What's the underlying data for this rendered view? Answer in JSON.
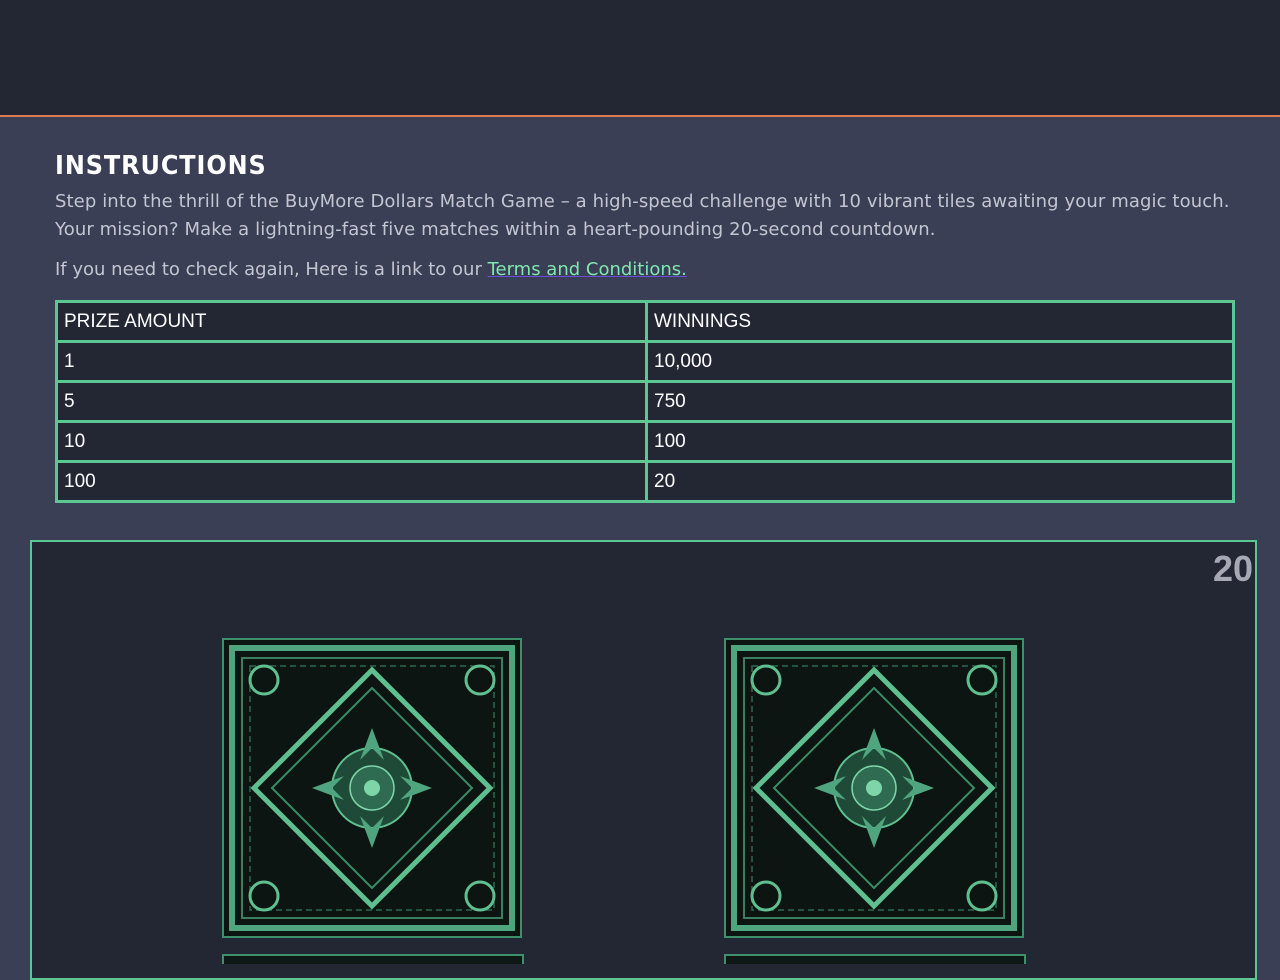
{
  "instructions": {
    "title": "INSTRUCTIONS",
    "description": "Step into the thrill of the BuyMore Dollars Match Game – a high-speed challenge with 10 vibrant tiles awaiting your magic touch. Your mission? Make a lightning-fast five matches within a heart-pounding 20-second countdown.",
    "link_prefix": "If you need to check again, Here is a link to our ",
    "link_text": "Terms and Conditions."
  },
  "prize_table": {
    "headers": [
      "PRIZE AMOUNT",
      "WINNINGS"
    ],
    "rows": [
      [
        "1",
        "10,000"
      ],
      [
        "5",
        "750"
      ],
      [
        "10",
        "100"
      ],
      [
        "100",
        "20"
      ]
    ]
  },
  "game": {
    "timer": "20",
    "tile_icon": "ornate-card-back-icon"
  },
  "colors": {
    "accent_border": "#5cc793",
    "link": "#7ee8b0",
    "topbar_rule": "#d97a55",
    "panel_bg": "#232734",
    "page_bg": "#3a3f55"
  }
}
